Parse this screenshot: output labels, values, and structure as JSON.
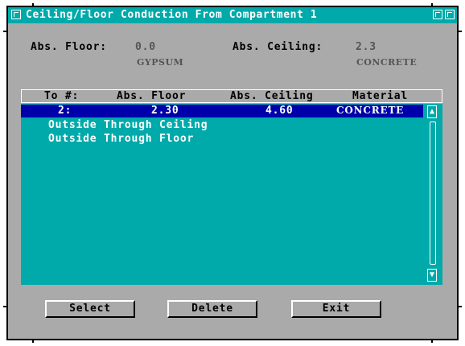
{
  "window": {
    "title": "Ceiling/Floor Conduction From Compartment 1"
  },
  "info": {
    "abs_floor_label": "Abs. Floor:",
    "abs_floor_value": "0.0",
    "floor_material": "GYPSUM",
    "abs_ceiling_label": "Abs. Ceiling:",
    "abs_ceiling_value": "2.3",
    "ceiling_material": "CONCRETE"
  },
  "table": {
    "headers": [
      "To #:",
      "Abs. Floor",
      "Abs. Ceiling",
      "Material"
    ],
    "rows": [
      {
        "to": "2:",
        "floor": "2.30",
        "ceiling": "4.60",
        "material": "CONCRETE",
        "selected": true
      },
      {
        "to": "Outside Through Ceiling",
        "floor": "",
        "ceiling": "",
        "material": ""
      },
      {
        "to": "Outside Through Floor",
        "floor": "",
        "ceiling": "",
        "material": ""
      }
    ]
  },
  "buttons": {
    "select": "Select",
    "delete": "Delete",
    "exit": "Exit"
  },
  "icons": {
    "system_menu": "window-menu-icon",
    "minimize": "minimize-icon",
    "maximize": "maximize-icon",
    "scroll_up": "scroll-up-arrow-icon",
    "scroll_down": "scroll-down-arrow-icon"
  },
  "colors": {
    "titlebar": "#00aaaa",
    "list_background": "#00aaaa",
    "selection": "#0000aa",
    "window_background": "#aaaaaa"
  }
}
